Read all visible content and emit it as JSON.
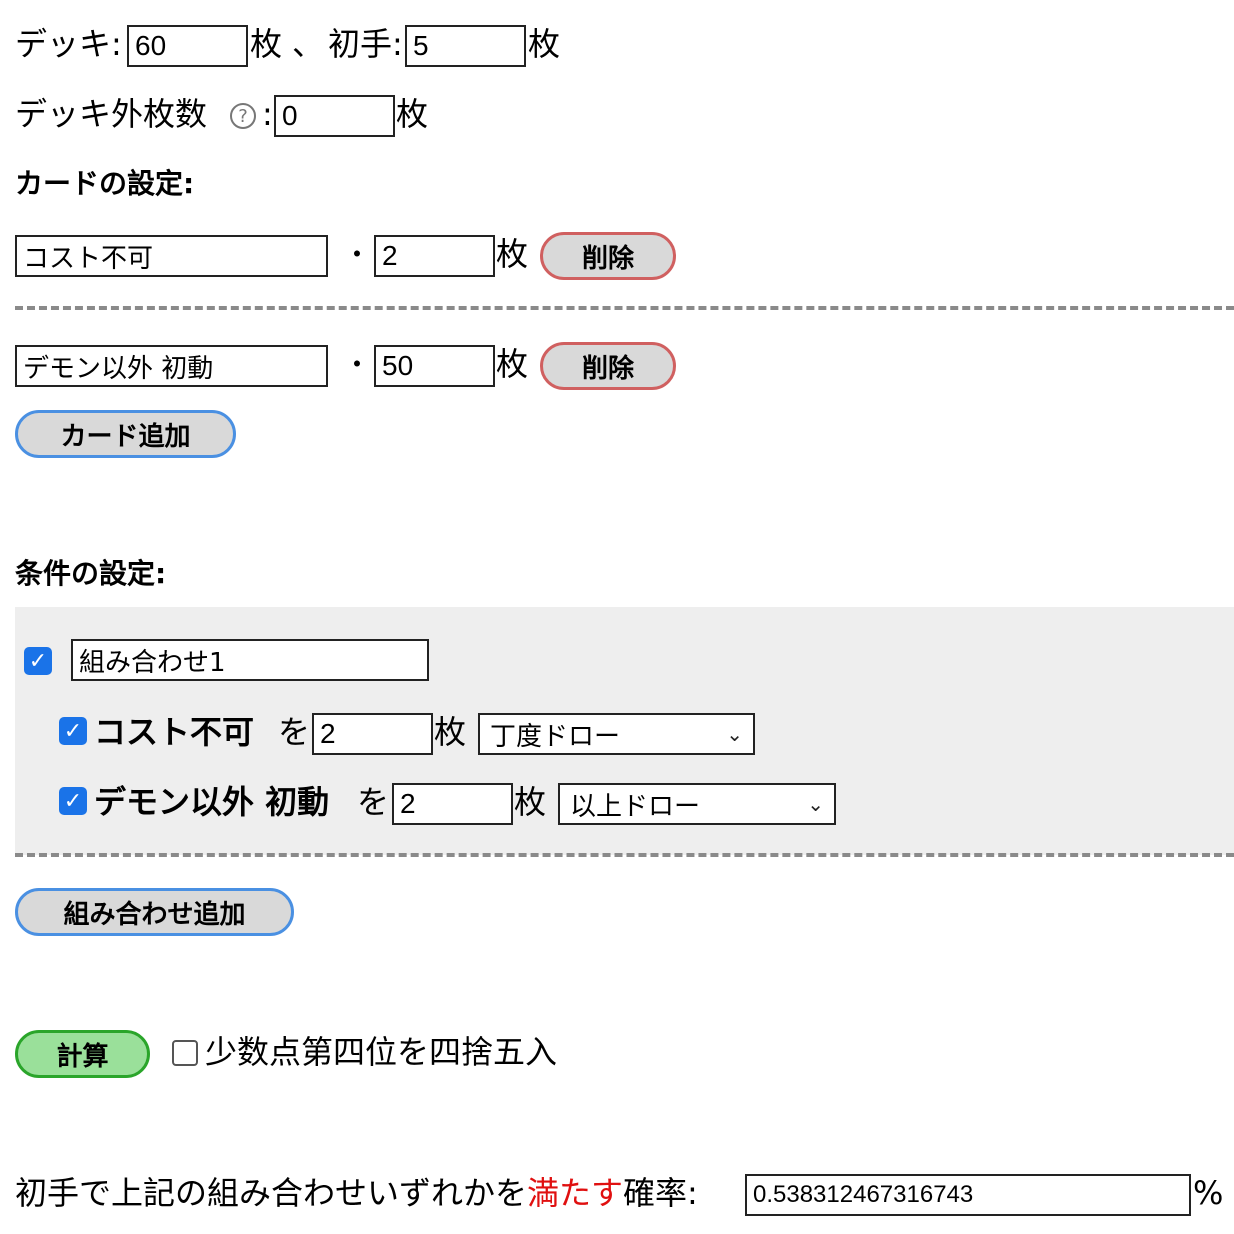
{
  "deck": {
    "deck_label": "デッキ:",
    "deck_value": "60",
    "unit": "枚",
    "separator": "、",
    "hand_label": "初手:",
    "hand_value": "5",
    "outside_label": "デッキ外枚数",
    "help_glyph": "?",
    "colon": ":",
    "outside_value": "0"
  },
  "cards_section": {
    "title": "カードの設定:",
    "dot": "・",
    "unit": "枚",
    "delete_label": "削除",
    "items": [
      {
        "name": "コスト不可",
        "count": "2"
      },
      {
        "name": "デモン以外 初動",
        "count": "50"
      }
    ],
    "add_label": "カード追加"
  },
  "conditions_section": {
    "title": "条件の設定:",
    "combo_name": "組み合わせ1",
    "combo_checked": true,
    "rows": [
      {
        "card": "コスト不可",
        "particle": "を",
        "count": "2",
        "unit": "枚",
        "mode": "丁度ドロー",
        "checked": true
      },
      {
        "card": "デモン以外 初動",
        "particle": "を",
        "count": "2",
        "unit": "枚",
        "mode": "以上ドロー",
        "checked": true
      }
    ],
    "add_label": "組み合わせ追加"
  },
  "calc": {
    "button_label": "計算",
    "round_label": "少数点第四位を四捨五入",
    "round_checked": false
  },
  "result": {
    "prefix": "初手で上記の組み合わせいずれかを",
    "highlight": "満たす",
    "suffix": "確率:",
    "value": "0.538312467316743",
    "percent": "%"
  },
  "colors": {
    "add_button_border": "#4a90e2",
    "delete_button_border": "#d06060",
    "calc_button_border": "#2aa52a",
    "calc_button_fill": "#9ae09a",
    "highlight_text": "#e01010",
    "condition_box_bg": "#eeeeee"
  },
  "icons": {
    "help": "help-circle-icon",
    "check": "checkmark-icon",
    "chevron": "chevron-down-icon"
  }
}
